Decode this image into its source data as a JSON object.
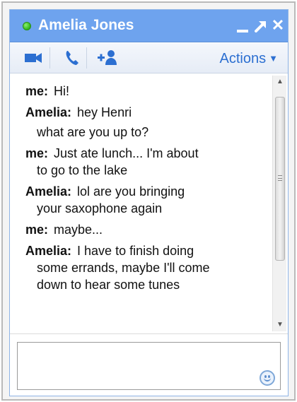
{
  "window": {
    "contact_name": "Amelia Jones",
    "status": "online",
    "controls": {
      "minimize_icon": "minimize-icon",
      "popout_icon": "popout-arrow-icon",
      "close_symbol": "✕"
    }
  },
  "toolbar": {
    "video_icon": "video-camera-icon",
    "call_icon": "phone-icon",
    "add_icon": "add-person-icon",
    "actions_label": "Actions",
    "actions_arrow": "▼"
  },
  "messages": [
    {
      "sender": "me:",
      "text": "Hi!"
    },
    {
      "sender": "Amelia:",
      "text": "hey Henri"
    },
    {
      "sender": "",
      "text": "what are you up to?"
    },
    {
      "sender": "me:",
      "text": "Just ate lunch... I'm about",
      "continuation": "to go to the lake"
    },
    {
      "sender": "Amelia:",
      "text": "lol are you bringing",
      "continuation": "your saxophone again"
    },
    {
      "sender": "me:",
      "text": "maybe..."
    },
    {
      "sender": "Amelia:",
      "text": "I have to finish doing",
      "continuation": "some errands, maybe I'll come",
      "continuation2": "down to hear some tunes"
    }
  ],
  "input": {
    "value": "",
    "emoji_icon": "smiley-icon"
  },
  "colors": {
    "titlebar": "#6ea3ee",
    "status_online": "#2fb51a",
    "actions_link": "#2c6fd1"
  }
}
